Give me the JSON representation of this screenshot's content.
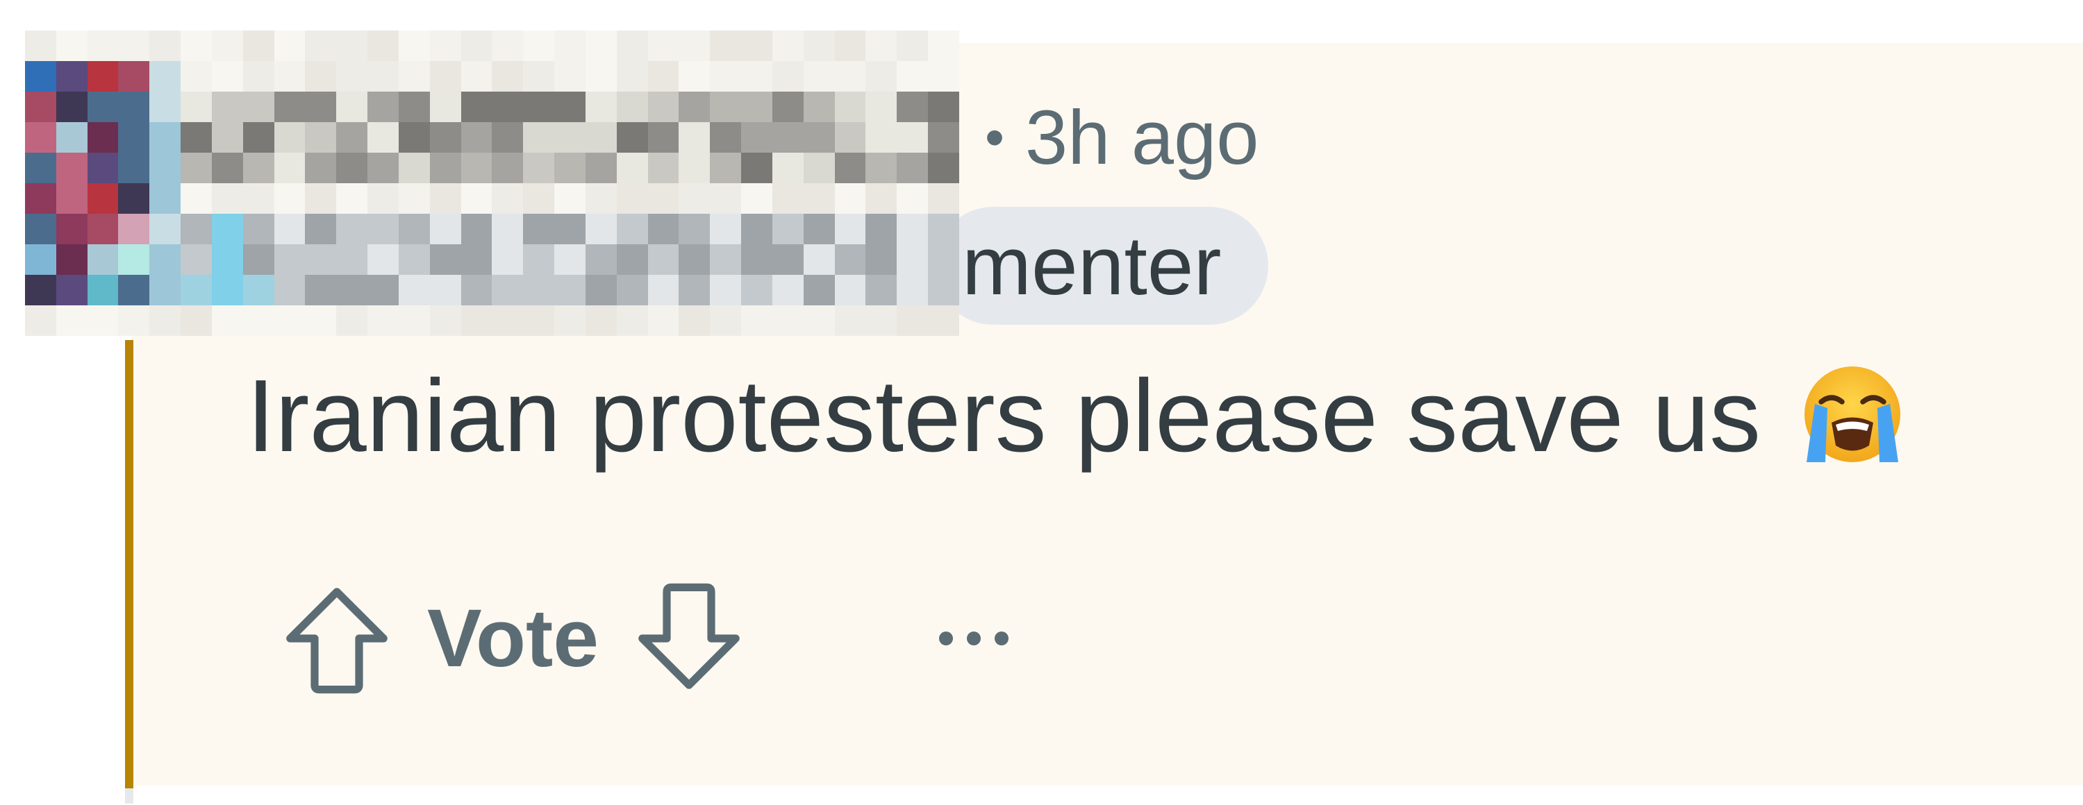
{
  "comment": {
    "timestamp": "3h ago",
    "separator": "•",
    "flair_visible": "menter",
    "text": "Iranian protesters please save us",
    "emoji_icon": "loudly-crying-face-emoji"
  },
  "actions": {
    "vote_label": "Vote",
    "upvote_icon": "arrow-up-outline-icon",
    "downvote_icon": "arrow-down-outline-icon",
    "more_label": "···"
  },
  "colors": {
    "comment_bg": "#fdf9f0",
    "thread_line": "#b78503",
    "text": "#333d42",
    "meta": "#5c6c74",
    "flair_bg": "#e5e9ee"
  }
}
